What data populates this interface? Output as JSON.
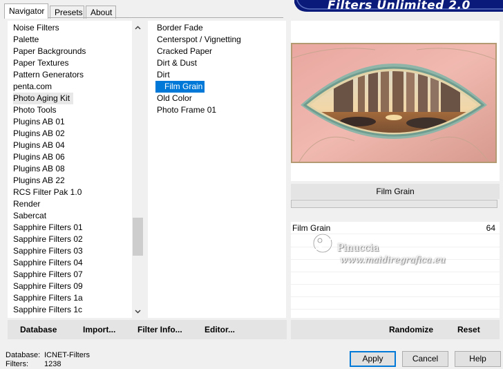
{
  "tabs": [
    "Navigator",
    "Presets",
    "About"
  ],
  "banner_title": "Filters Unlimited 2.0",
  "categories": [
    "Noise Filters",
    "Palette",
    "Paper Backgrounds",
    "Paper Textures",
    "Pattern Generators",
    "penta.com",
    "Photo Aging Kit",
    "Photo Tools",
    "Plugins AB 01",
    "Plugins AB 02",
    "Plugins AB 04",
    "Plugins AB 06",
    "Plugins AB 08",
    "Plugins AB 22",
    "RCS Filter Pak 1.0",
    "Render",
    "Sabercat",
    "Sapphire Filters 01",
    "Sapphire Filters 02",
    "Sapphire Filters 03",
    "Sapphire Filters 04",
    "Sapphire Filters 07",
    "Sapphire Filters 09",
    "Sapphire Filters 1a",
    "Sapphire Filters 1c"
  ],
  "selected_category": "Photo Aging Kit",
  "filters": [
    "Border Fade",
    "Centerspot / Vignetting",
    "Cracked Paper",
    "Dirt & Dust",
    "Dirt",
    "Film Grain",
    "Old Color",
    "Photo Frame 01"
  ],
  "selected_filter": "Film Grain",
  "left_buttons": {
    "database": "Database",
    "import": "Import...",
    "filter_info": "Filter Info...",
    "editor": "Editor..."
  },
  "filter_title": "Film Grain",
  "parameters": [
    {
      "name": "Film Grain",
      "value": "64"
    }
  ],
  "right_buttons": {
    "randomize": "Randomize",
    "reset": "Reset"
  },
  "watermark": {
    "line1": "Pinuccia",
    "line2": "www.maidiregrafica.eu"
  },
  "status": {
    "database_label": "Database:",
    "database_value": "ICNET-Filters",
    "filters_label": "Filters:",
    "filters_value": "1238"
  },
  "dialog_buttons": {
    "apply": "Apply",
    "cancel": "Cancel",
    "help": "Help"
  },
  "colors": {
    "selection": "#0078d7",
    "banner": "#0a1a7a",
    "panel_bg": "#f0f0f0"
  },
  "icons": {
    "scroll_up": "chevron-up-icon",
    "scroll_down": "chevron-down-icon"
  }
}
